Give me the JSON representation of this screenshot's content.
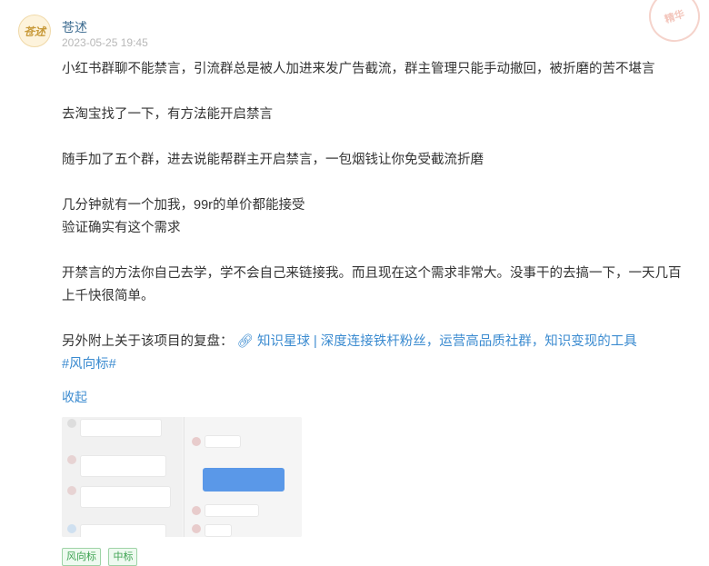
{
  "post": {
    "author": "苍述",
    "avatar_text": "苍述",
    "time": "2023-05-25 19:45",
    "stamp_text": "精华",
    "paragraphs": {
      "p1": "小红书群聊不能禁言，引流群总是被人加进来发广告截流，群主管理只能手动撤回，被折磨的苦不堪言",
      "p2": "去淘宝找了一下，有方法能开启禁言",
      "p3": "随手加了五个群，进去说能帮群主开启禁言，一包烟钱让你免受截流折磨",
      "p4a": "几分钟就有一个加我，99r的单价都能接受",
      "p4b": "验证确实有这个需求",
      "p5": "开禁言的方法你自己去学，学不会自己来链接我。而且现在这个需求非常大。没事干的去搞一下，一天几百上千快很简单。",
      "p6_prefix": "另外附上关于该项目的复盘：",
      "p6_link_icon": "link-icon",
      "p6_link": "知识星球 | 深度连接铁杆粉丝，运营高品质社群，知识变现的工具",
      "p6_tag": "#风向标#"
    },
    "collapse_label": "收起",
    "chips": [
      "风向标",
      "中标"
    ]
  },
  "colors": {
    "link": "#3b8bd0",
    "author": "#3b6a8f",
    "chip_green": "#3ea352"
  }
}
